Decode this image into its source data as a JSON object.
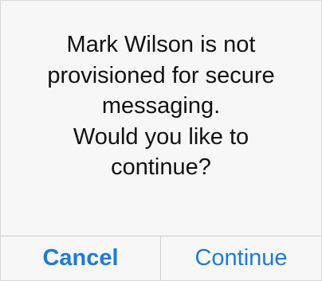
{
  "alert": {
    "message_lines": [
      "Mark Wilson is not",
      "provisioned for secure",
      "messaging.",
      "Would you like to",
      "continue?"
    ],
    "cancel_label": "Cancel",
    "continue_label": "Continue"
  },
  "colors": {
    "accent": "#1f7ad6",
    "text": "#111111",
    "background": "#f7f7f7",
    "divider": "#cfcfcf"
  }
}
